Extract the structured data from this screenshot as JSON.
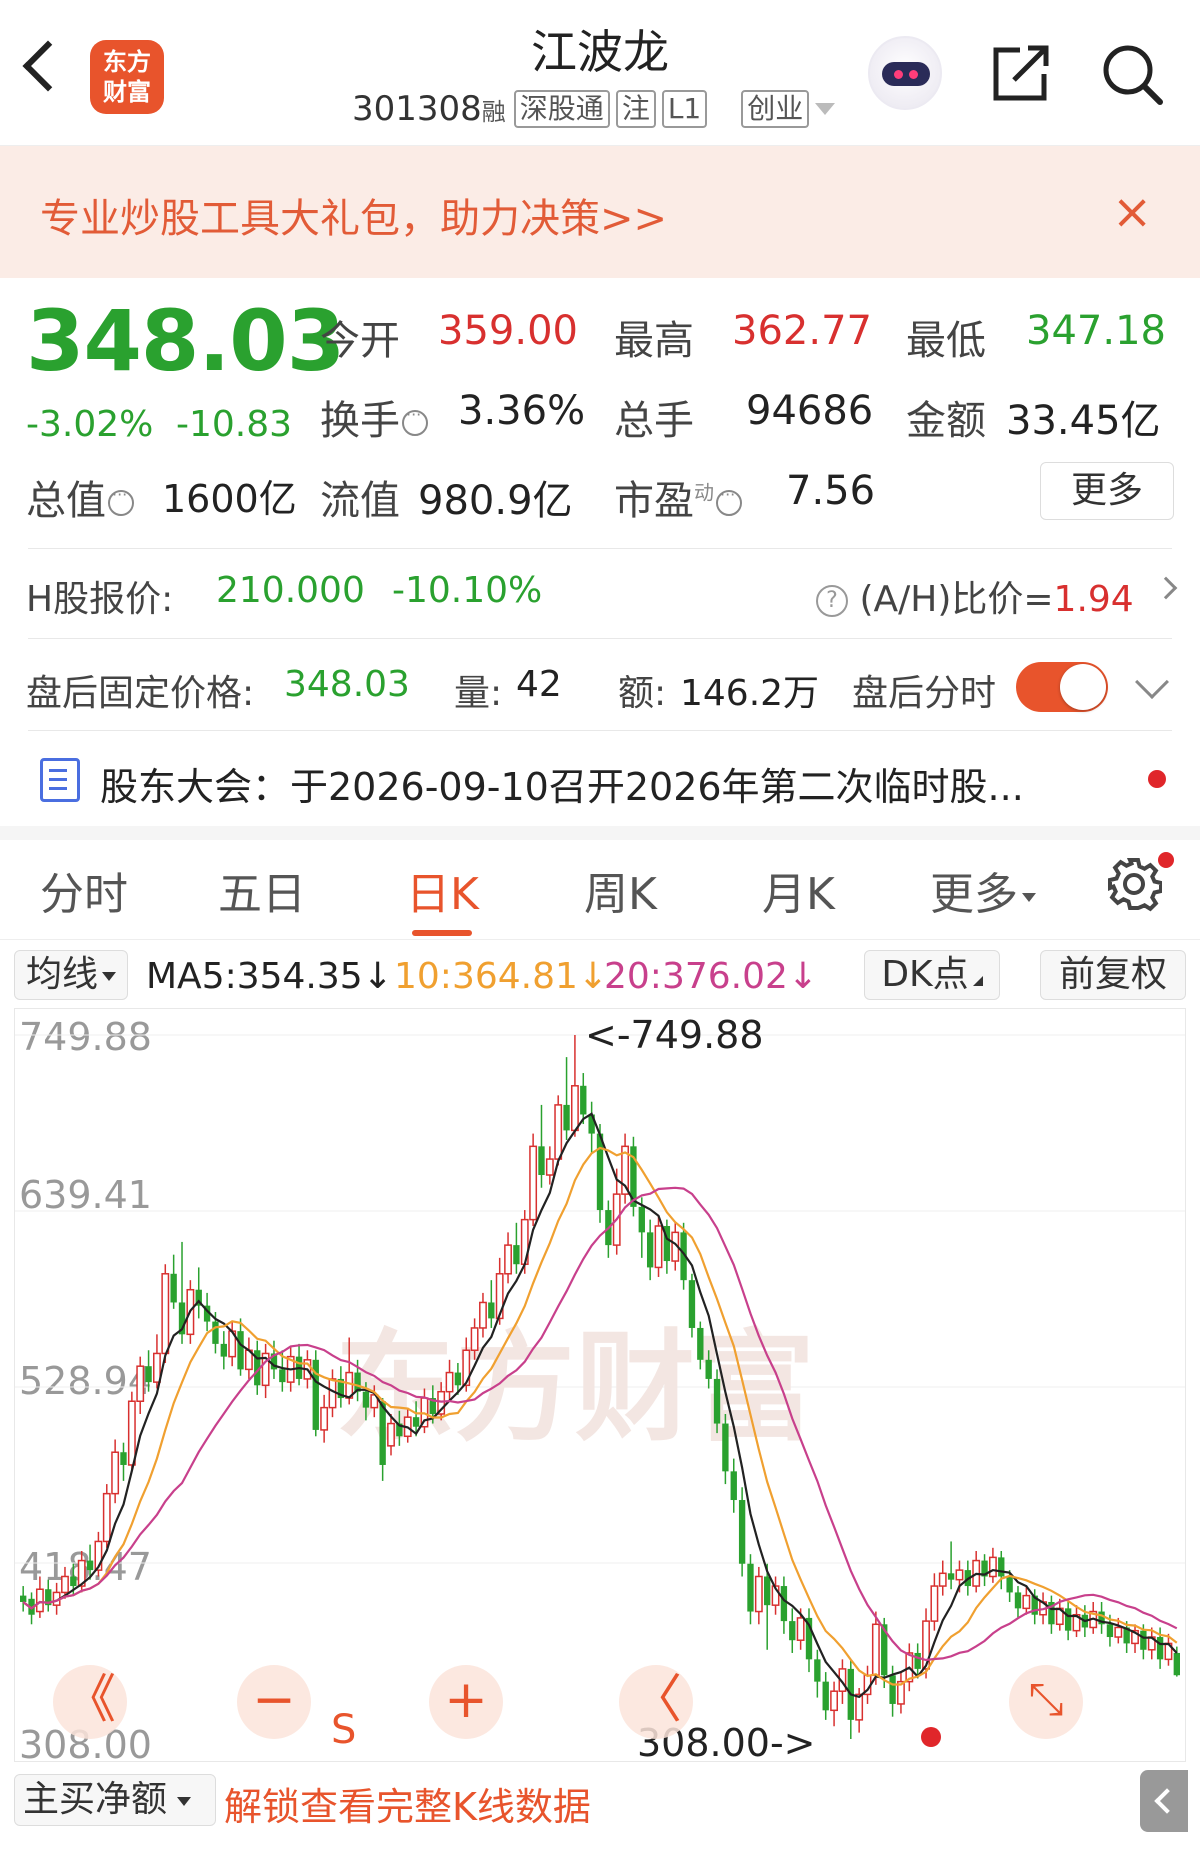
{
  "header": {
    "logo_text_1": "东方",
    "logo_text_2": "财富",
    "stock_name": "江波龙",
    "stock_code": "301308",
    "code_suffix": "融",
    "tags": [
      "深股通",
      "注",
      "L1"
    ],
    "board": "创业"
  },
  "promo": {
    "text": "专业炒股工具大礼包，助力决策>>",
    "close": "×"
  },
  "quote": {
    "price": "348.03",
    "change_pct": "-3.02%",
    "change_amt": "-10.83",
    "open_label": "今开",
    "open": "359.00",
    "high_label": "最高",
    "high": "362.77",
    "low_label": "最低",
    "low": "347.18",
    "turnover_label": "换手",
    "turnover": "3.36%",
    "volume_label": "总手",
    "volume": "94686",
    "amount_label": "金额",
    "amount": "33.45亿",
    "mktcap_label": "总值",
    "mktcap": "1600亿",
    "float_label": "流值",
    "float": "980.9亿",
    "pe_label": "市盈",
    "pe_sup": "动",
    "pe": "7.56",
    "more": "更多"
  },
  "hshare": {
    "label": "H股报价:",
    "price": "210.000",
    "pct": "-10.10%",
    "ah_label": "(A/H)比价=",
    "ah_value": "1.94"
  },
  "afterhours": {
    "label": "盘后固定价格:",
    "price": "348.03",
    "vol_label": "量:",
    "vol": "42",
    "amt_label": "额:",
    "amt": "146.2万",
    "timeshare": "盘后分时"
  },
  "notice": {
    "text": "股东大会：于2026-09-10召开2026年第二次临时股..."
  },
  "tabs": [
    "分时",
    "五日",
    "日K",
    "周K",
    "月K",
    "更多"
  ],
  "active_tab": "日K",
  "ma": {
    "selector": "均线",
    "ma5": "MA5:354.35↓",
    "ma10": "10:364.81↓",
    "ma20": "20:376.02↓",
    "dk": "DK点",
    "adjust": "前复权"
  },
  "colors": {
    "accent": "#e8542c",
    "up": "#d8302f",
    "down": "#2aa12f",
    "ma5": "#222222",
    "ma10": "#f0a030",
    "ma20": "#c8408c"
  },
  "chart_data": {
    "type": "candlestick",
    "y_ticks": [
      "749.88",
      "639.41",
      "528.94",
      "418.47",
      "308.00"
    ],
    "ylim": [
      308.0,
      749.88
    ],
    "max_label": "<-749.88",
    "min_label": "308.00->",
    "watermark": "东方财富",
    "candles": [
      {
        "o": 398,
        "c": 394,
        "h": 404,
        "l": 388
      },
      {
        "o": 396,
        "c": 386,
        "h": 400,
        "l": 380
      },
      {
        "o": 388,
        "c": 402,
        "h": 410,
        "l": 384
      },
      {
        "o": 402,
        "c": 392,
        "h": 408,
        "l": 388
      },
      {
        "o": 392,
        "c": 400,
        "h": 406,
        "l": 386
      },
      {
        "o": 400,
        "c": 410,
        "h": 416,
        "l": 396
      },
      {
        "o": 410,
        "c": 404,
        "h": 418,
        "l": 398
      },
      {
        "o": 404,
        "c": 420,
        "h": 426,
        "l": 400
      },
      {
        "o": 420,
        "c": 414,
        "h": 430,
        "l": 408
      },
      {
        "o": 414,
        "c": 432,
        "h": 438,
        "l": 410
      },
      {
        "o": 432,
        "c": 462,
        "h": 468,
        "l": 428
      },
      {
        "o": 462,
        "c": 488,
        "h": 496,
        "l": 456
      },
      {
        "o": 488,
        "c": 480,
        "h": 494,
        "l": 470
      },
      {
        "o": 480,
        "c": 520,
        "h": 526,
        "l": 476
      },
      {
        "o": 520,
        "c": 542,
        "h": 548,
        "l": 512
      },
      {
        "o": 542,
        "c": 532,
        "h": 552,
        "l": 526
      },
      {
        "o": 532,
        "c": 550,
        "h": 562,
        "l": 528
      },
      {
        "o": 550,
        "c": 600,
        "h": 606,
        "l": 544
      },
      {
        "o": 600,
        "c": 582,
        "h": 612,
        "l": 578
      },
      {
        "o": 582,
        "c": 562,
        "h": 620,
        "l": 556
      },
      {
        "o": 562,
        "c": 590,
        "h": 596,
        "l": 556
      },
      {
        "o": 590,
        "c": 580,
        "h": 604,
        "l": 572
      },
      {
        "o": 580,
        "c": 570,
        "h": 588,
        "l": 564
      },
      {
        "o": 570,
        "c": 556,
        "h": 576,
        "l": 550
      },
      {
        "o": 556,
        "c": 548,
        "h": 564,
        "l": 540
      },
      {
        "o": 548,
        "c": 564,
        "h": 570,
        "l": 542
      },
      {
        "o": 564,
        "c": 540,
        "h": 572,
        "l": 536
      },
      {
        "o": 540,
        "c": 552,
        "h": 560,
        "l": 534
      },
      {
        "o": 552,
        "c": 530,
        "h": 558,
        "l": 524
      },
      {
        "o": 530,
        "c": 550,
        "h": 556,
        "l": 522
      },
      {
        "o": 550,
        "c": 540,
        "h": 558,
        "l": 534
      },
      {
        "o": 540,
        "c": 532,
        "h": 552,
        "l": 526
      },
      {
        "o": 532,
        "c": 548,
        "h": 554,
        "l": 526
      },
      {
        "o": 548,
        "c": 534,
        "h": 556,
        "l": 530
      },
      {
        "o": 534,
        "c": 546,
        "h": 552,
        "l": 528
      },
      {
        "o": 546,
        "c": 502,
        "h": 552,
        "l": 498
      },
      {
        "o": 502,
        "c": 516,
        "h": 524,
        "l": 494
      },
      {
        "o": 516,
        "c": 534,
        "h": 540,
        "l": 510
      },
      {
        "o": 534,
        "c": 522,
        "h": 542,
        "l": 516
      },
      {
        "o": 522,
        "c": 538,
        "h": 560,
        "l": 518
      },
      {
        "o": 538,
        "c": 526,
        "h": 546,
        "l": 520
      },
      {
        "o": 526,
        "c": 516,
        "h": 532,
        "l": 508
      },
      {
        "o": 516,
        "c": 524,
        "h": 530,
        "l": 510
      },
      {
        "o": 520,
        "c": 480,
        "h": 522,
        "l": 470
      },
      {
        "o": 492,
        "c": 506,
        "h": 512,
        "l": 486
      },
      {
        "o": 506,
        "c": 498,
        "h": 514,
        "l": 492
      },
      {
        "o": 498,
        "c": 510,
        "h": 516,
        "l": 494
      },
      {
        "o": 510,
        "c": 504,
        "h": 520,
        "l": 498
      },
      {
        "o": 504,
        "c": 522,
        "h": 528,
        "l": 500
      },
      {
        "o": 522,
        "c": 512,
        "h": 530,
        "l": 506
      },
      {
        "o": 512,
        "c": 526,
        "h": 532,
        "l": 508
      },
      {
        "o": 526,
        "c": 538,
        "h": 546,
        "l": 520
      },
      {
        "o": 538,
        "c": 530,
        "h": 544,
        "l": 524
      },
      {
        "o": 530,
        "c": 552,
        "h": 560,
        "l": 526
      },
      {
        "o": 552,
        "c": 566,
        "h": 572,
        "l": 546
      },
      {
        "o": 566,
        "c": 582,
        "h": 588,
        "l": 560
      },
      {
        "o": 582,
        "c": 572,
        "h": 596,
        "l": 566
      },
      {
        "o": 572,
        "c": 600,
        "h": 610,
        "l": 568
      },
      {
        "o": 600,
        "c": 618,
        "h": 626,
        "l": 594
      },
      {
        "o": 618,
        "c": 606,
        "h": 632,
        "l": 600
      },
      {
        "o": 606,
        "c": 634,
        "h": 640,
        "l": 600
      },
      {
        "o": 634,
        "c": 680,
        "h": 688,
        "l": 630
      },
      {
        "o": 680,
        "c": 662,
        "h": 706,
        "l": 654
      },
      {
        "o": 662,
        "c": 672,
        "h": 680,
        "l": 656
      },
      {
        "o": 672,
        "c": 706,
        "h": 712,
        "l": 668
      },
      {
        "o": 706,
        "c": 690,
        "h": 736,
        "l": 684
      },
      {
        "o": 690,
        "c": 718,
        "h": 749.88,
        "l": 686
      },
      {
        "o": 718,
        "c": 700,
        "h": 726,
        "l": 694
      },
      {
        "o": 700,
        "c": 688,
        "h": 708,
        "l": 676
      },
      {
        "o": 688,
        "c": 640,
        "h": 694,
        "l": 632
      },
      {
        "o": 640,
        "c": 618,
        "h": 646,
        "l": 610
      },
      {
        "o": 618,
        "c": 650,
        "h": 666,
        "l": 612
      },
      {
        "o": 650,
        "c": 680,
        "h": 688,
        "l": 644
      },
      {
        "o": 680,
        "c": 642,
        "h": 686,
        "l": 636
      },
      {
        "o": 642,
        "c": 626,
        "h": 648,
        "l": 610
      },
      {
        "o": 626,
        "c": 604,
        "h": 634,
        "l": 596
      },
      {
        "o": 604,
        "c": 630,
        "h": 636,
        "l": 598
      },
      {
        "o": 630,
        "c": 608,
        "h": 634,
        "l": 600
      },
      {
        "o": 608,
        "c": 626,
        "h": 632,
        "l": 602
      },
      {
        "o": 626,
        "c": 596,
        "h": 632,
        "l": 590
      },
      {
        "o": 596,
        "c": 566,
        "h": 600,
        "l": 560
      },
      {
        "o": 566,
        "c": 546,
        "h": 570,
        "l": 540
      },
      {
        "o": 546,
        "c": 534,
        "h": 552,
        "l": 528
      },
      {
        "o": 534,
        "c": 506,
        "h": 540,
        "l": 500
      },
      {
        "o": 506,
        "c": 476,
        "h": 512,
        "l": 468
      },
      {
        "o": 476,
        "c": 458,
        "h": 484,
        "l": 450
      },
      {
        "o": 458,
        "c": 418,
        "h": 466,
        "l": 410
      },
      {
        "o": 418,
        "c": 388,
        "h": 424,
        "l": 380
      },
      {
        "o": 388,
        "c": 410,
        "h": 416,
        "l": 380
      },
      {
        "o": 410,
        "c": 392,
        "h": 418,
        "l": 364
      },
      {
        "o": 392,
        "c": 404,
        "h": 410,
        "l": 386
      },
      {
        "o": 404,
        "c": 382,
        "h": 410,
        "l": 374
      },
      {
        "o": 382,
        "c": 370,
        "h": 390,
        "l": 362
      },
      {
        "o": 370,
        "c": 384,
        "h": 390,
        "l": 364
      },
      {
        "o": 384,
        "c": 358,
        "h": 390,
        "l": 350
      },
      {
        "o": 358,
        "c": 344,
        "h": 364,
        "l": 334
      },
      {
        "o": 344,
        "c": 326,
        "h": 350,
        "l": 320
      },
      {
        "o": 326,
        "c": 338,
        "h": 344,
        "l": 316
      },
      {
        "o": 338,
        "c": 352,
        "h": 358,
        "l": 330
      },
      {
        "o": 352,
        "c": 320,
        "h": 358,
        "l": 308
      },
      {
        "o": 320,
        "c": 336,
        "h": 340,
        "l": 312
      },
      {
        "o": 336,
        "c": 348,
        "h": 354,
        "l": 330
      },
      {
        "o": 348,
        "c": 380,
        "h": 388,
        "l": 342
      },
      {
        "o": 380,
        "c": 348,
        "h": 384,
        "l": 340
      },
      {
        "o": 348,
        "c": 330,
        "h": 354,
        "l": 322
      },
      {
        "o": 330,
        "c": 344,
        "h": 350,
        "l": 324
      },
      {
        "o": 344,
        "c": 362,
        "h": 368,
        "l": 338
      },
      {
        "o": 362,
        "c": 352,
        "h": 368,
        "l": 346
      },
      {
        "o": 352,
        "c": 382,
        "h": 390,
        "l": 346
      },
      {
        "o": 382,
        "c": 404,
        "h": 412,
        "l": 376
      },
      {
        "o": 404,
        "c": 412,
        "h": 420,
        "l": 398
      },
      {
        "o": 412,
        "c": 408,
        "h": 432,
        "l": 402
      },
      {
        "o": 408,
        "c": 414,
        "h": 420,
        "l": 400
      },
      {
        "o": 414,
        "c": 404,
        "h": 420,
        "l": 398
      },
      {
        "o": 404,
        "c": 420,
        "h": 426,
        "l": 400
      },
      {
        "o": 420,
        "c": 410,
        "h": 424,
        "l": 404
      },
      {
        "o": 410,
        "c": 422,
        "h": 428,
        "l": 406
      },
      {
        "o": 422,
        "c": 410,
        "h": 426,
        "l": 402
      },
      {
        "o": 410,
        "c": 400,
        "h": 414,
        "l": 394
      },
      {
        "o": 400,
        "c": 390,
        "h": 404,
        "l": 384
      },
      {
        "o": 390,
        "c": 398,
        "h": 404,
        "l": 386
      },
      {
        "o": 398,
        "c": 386,
        "h": 402,
        "l": 380
      },
      {
        "o": 386,
        "c": 394,
        "h": 400,
        "l": 380
      },
      {
        "o": 394,
        "c": 380,
        "h": 398,
        "l": 374
      },
      {
        "o": 380,
        "c": 390,
        "h": 396,
        "l": 376
      },
      {
        "o": 390,
        "c": 376,
        "h": 394,
        "l": 370
      },
      {
        "o": 376,
        "c": 386,
        "h": 392,
        "l": 372
      },
      {
        "o": 386,
        "c": 378,
        "h": 392,
        "l": 372
      },
      {
        "o": 378,
        "c": 388,
        "h": 394,
        "l": 374
      },
      {
        "o": 388,
        "c": 380,
        "h": 394,
        "l": 374
      },
      {
        "o": 380,
        "c": 372,
        "h": 386,
        "l": 366
      },
      {
        "o": 372,
        "c": 378,
        "h": 384,
        "l": 368
      },
      {
        "o": 378,
        "c": 368,
        "h": 382,
        "l": 362
      },
      {
        "o": 368,
        "c": 376,
        "h": 380,
        "l": 362
      },
      {
        "o": 376,
        "c": 364,
        "h": 380,
        "l": 358
      },
      {
        "o": 364,
        "c": 372,
        "h": 378,
        "l": 358
      },
      {
        "o": 372,
        "c": 358,
        "h": 378,
        "l": 352
      },
      {
        "o": 358,
        "c": 368,
        "h": 374,
        "l": 354
      },
      {
        "o": 362,
        "c": 348.03,
        "h": 366,
        "l": 347.18
      }
    ]
  },
  "chart_buttons": {
    "rewind": "《",
    "zoom_out": "−",
    "s_label": "S",
    "zoom_in": "+",
    "prev": "〈",
    "expand": "⤡"
  },
  "bottom": {
    "net_buy": "主买净额",
    "unlock": "解锁查看完整K线数据"
  }
}
